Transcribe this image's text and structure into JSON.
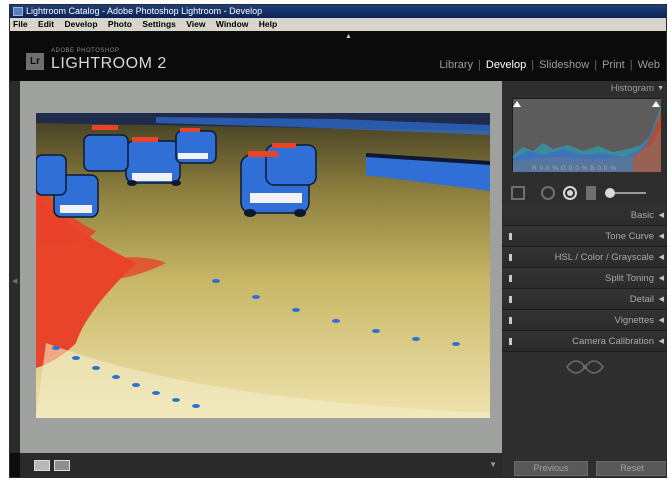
{
  "window": {
    "title": "Lightroom Catalog - Adobe Photoshop Lightroom - Develop"
  },
  "menu": [
    "File",
    "Edit",
    "Develop",
    "Photo",
    "Settings",
    "View",
    "Window",
    "Help"
  ],
  "header": {
    "brand_small": "ADOBE PHOTOSHOP",
    "brand_big": "LIGHTROOM 2",
    "badge": "Lr",
    "modules": [
      "Library",
      "Develop",
      "Slideshow",
      "Print",
      "Web"
    ],
    "active_module": "Develop"
  },
  "histogram": {
    "title": "Histogram",
    "readout": "R 0.0 % G 0.0 % B 0.0 %"
  },
  "panels": [
    "Basic",
    "Tone Curve",
    "HSL / Color / Grayscale",
    "Split Toning",
    "Detail",
    "Vignettes",
    "Camera Calibration"
  ],
  "buttons": {
    "previous": "Previous",
    "reset": "Reset"
  },
  "colors": {
    "clip_shadow": "#2f6fd6",
    "clip_highlight": "#e8442a",
    "accent": "#ffffff"
  },
  "icons": [
    "crop-icon",
    "spot-removal-icon",
    "red-eye-icon",
    "graduated-filter-icon",
    "adjustment-brush-icon",
    "loupe-view-icon",
    "before-after-icon",
    "panel-collapse-icon"
  ]
}
